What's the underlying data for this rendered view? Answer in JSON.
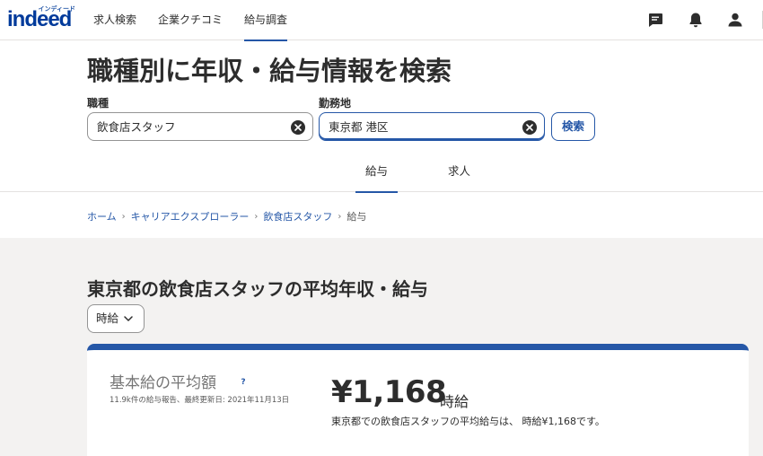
{
  "header": {
    "logo": "indeed",
    "logo_kana": "インディード",
    "nav": [
      {
        "label": "求人検索",
        "active": false
      },
      {
        "label": "企業クチコミ",
        "active": false
      },
      {
        "label": "給与調査",
        "active": true
      }
    ],
    "icons": [
      "message-icon",
      "bell-icon",
      "user-icon"
    ]
  },
  "search": {
    "title": "職種別に年収・給与情報を検索",
    "job_label": "職種",
    "job_value": "飲食店スタッフ",
    "location_label": "勤務地",
    "location_value": "東京都 港区",
    "search_button": "検索"
  },
  "tabs": [
    {
      "label": "給与",
      "active": true
    },
    {
      "label": "求人",
      "active": false
    }
  ],
  "breadcrumb": {
    "items": [
      "ホーム",
      "キャリアエクスプローラー",
      "飲食店スタッフ"
    ],
    "current": "給与"
  },
  "salary": {
    "section_title": "東京都の飲食店スタッフの平均年収・給与",
    "period_selected": "時給",
    "card_title": "基本給の平均額",
    "help_symbol": "?",
    "meta": "11.9k件の給与報告、最終更新日: 2021年11月13日",
    "amount": "¥1,168",
    "unit": "時給",
    "summary": "東京都での飲食店スタッフの平均給与は、 時給¥1,168です。"
  },
  "colors": {
    "brand": "#2557a7",
    "logo": "#003a9b",
    "text": "#2d2d2d",
    "section_bg": "#f3f2f1"
  }
}
